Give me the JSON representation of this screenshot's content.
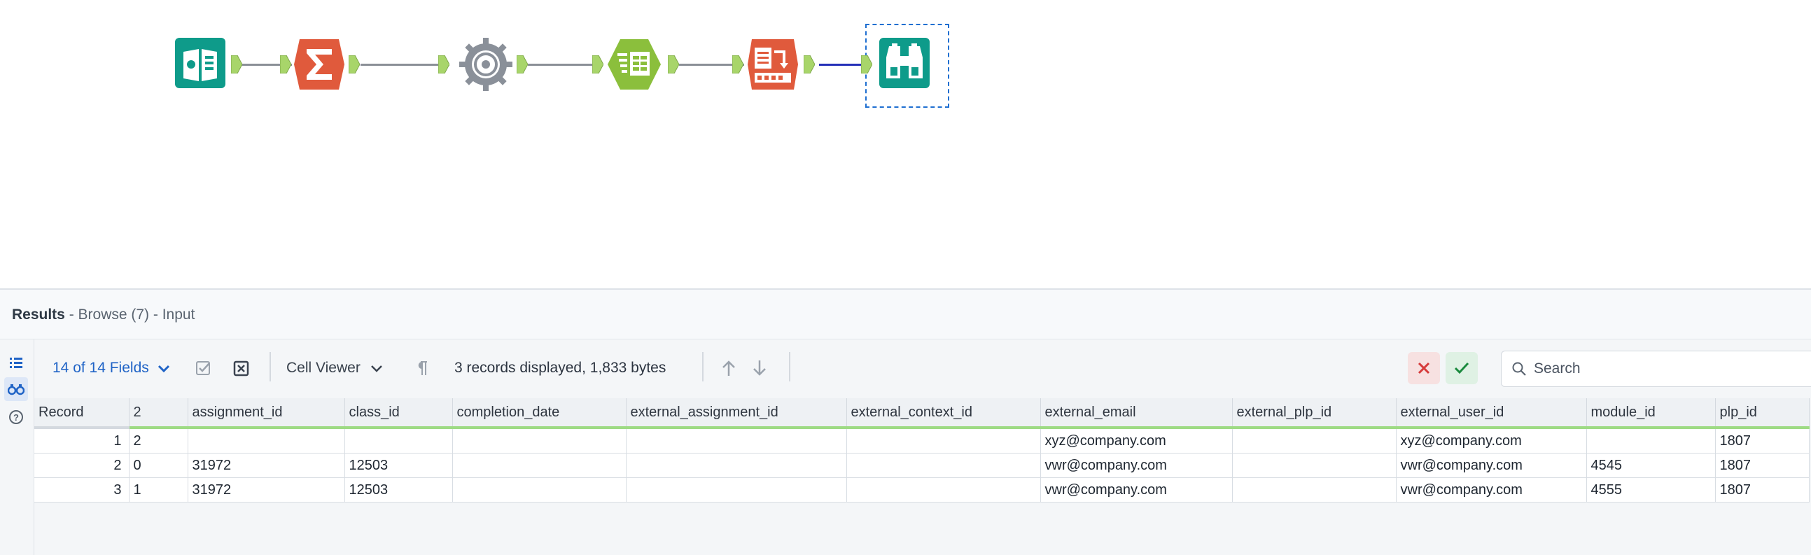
{
  "workflow": {
    "tools": [
      {
        "name": "input-data-tool",
        "icon": "book-icon",
        "color": "#0e9b8a"
      },
      {
        "name": "summarize-tool",
        "icon": "sigma-icon",
        "color": "#e05a3c"
      },
      {
        "name": "generate-tool",
        "icon": "gear-icon",
        "color": "#8a9099"
      },
      {
        "name": "select-tool",
        "icon": "table-icon",
        "color": "#8bbf3c"
      },
      {
        "name": "transpose-tool",
        "icon": "transpose-icon",
        "color": "#e05a3c"
      },
      {
        "name": "browse-tool",
        "icon": "binoculars-icon",
        "color": "#0e9b8a"
      }
    ],
    "colors": {
      "anchor": "#a8d56a",
      "wire": "#8a8f96",
      "selected_wire": "#2430b8",
      "selection": "#1f6fd1"
    }
  },
  "results": {
    "title": "Results",
    "subtitle": " - Browse (7) - Input",
    "rail": [
      {
        "icon": "list-icon",
        "active": false
      },
      {
        "icon": "binoculars-icon",
        "active": true
      },
      {
        "icon": "help-icon",
        "active": false
      }
    ],
    "toolbar": {
      "fields_label": "14 of 14 Fields",
      "cell_viewer_label": "Cell Viewer",
      "records_info": "3 records displayed, 1,833 bytes",
      "search_placeholder": "Search"
    },
    "grid": {
      "columns": [
        "Record",
        "2",
        "assignment_id",
        "class_id",
        "completion_date",
        "external_assignment_id",
        "external_context_id",
        "external_email",
        "external_plp_id",
        "external_user_id",
        "module_id",
        "plp_id"
      ],
      "rows": [
        [
          "1",
          "2",
          "",
          "",
          "",
          "",
          "",
          "xyz@company.com",
          "",
          "xyz@company.com",
          "",
          "1807"
        ],
        [
          "2",
          "0",
          "31972",
          "12503",
          "",
          "",
          "",
          "vwr@company.com",
          "",
          "vwr@company.com",
          "4545",
          "1807"
        ],
        [
          "3",
          "1",
          "31972",
          "12503",
          "",
          "",
          "",
          "vwr@company.com",
          "",
          "vwr@company.com",
          "4555",
          "1807"
        ]
      ]
    }
  }
}
